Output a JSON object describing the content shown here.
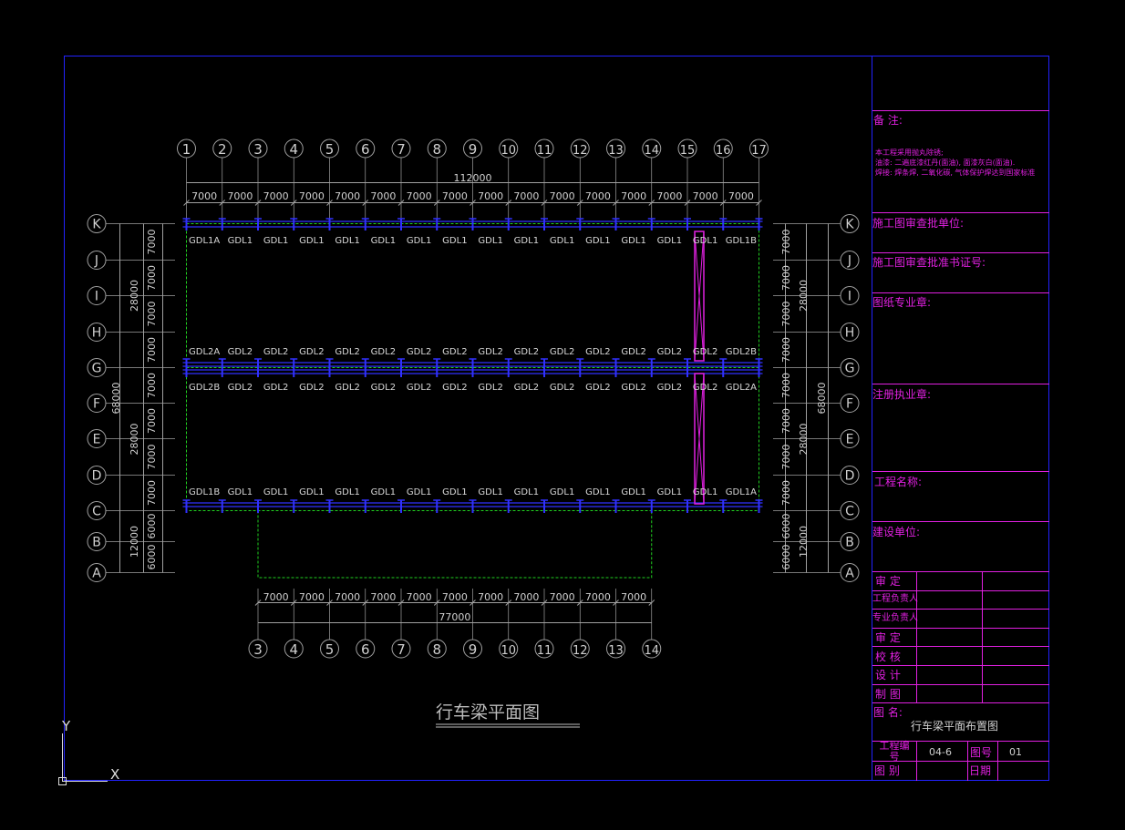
{
  "drawing": {
    "title": "行车梁平面图",
    "total_width": "112000",
    "lower_total_width": "77000",
    "bay": "7000",
    "columns": [
      "1",
      "2",
      "3",
      "4",
      "5",
      "6",
      "7",
      "8",
      "9",
      "10",
      "11",
      "12",
      "13",
      "14",
      "15",
      "16",
      "17"
    ],
    "lower_columns": [
      "3",
      "4",
      "5",
      "6",
      "7",
      "8",
      "9",
      "10",
      "11",
      "12",
      "13",
      "14"
    ],
    "rows": [
      "K",
      "J",
      "I",
      "H",
      "G",
      "F",
      "E",
      "D",
      "C",
      "B",
      "A"
    ],
    "row_spacings": [
      "7000",
      "7000",
      "7000",
      "7000",
      "7000",
      "7000",
      "7000",
      "7000",
      "6000",
      "6000"
    ],
    "group_dims": [
      "28000",
      "28000",
      "12000"
    ],
    "total_height": "68000",
    "beam_rows": [
      [
        "GDL1A",
        "GDL1",
        "GDL1",
        "GDL1",
        "GDL1",
        "GDL1",
        "GDL1",
        "GDL1",
        "GDL1",
        "GDL1",
        "GDL1",
        "GDL1",
        "GDL1",
        "GDL1",
        "GDL1",
        "GDL1B"
      ],
      [
        "GDL2A",
        "GDL2",
        "GDL2",
        "GDL2",
        "GDL2",
        "GDL2",
        "GDL2",
        "GDL2",
        "GDL2",
        "GDL2",
        "GDL2",
        "GDL2",
        "GDL2",
        "GDL2",
        "GDL2",
        "GDL2B"
      ],
      [
        "GDL2B",
        "GDL2",
        "GDL2",
        "GDL2",
        "GDL2",
        "GDL2",
        "GDL2",
        "GDL2",
        "GDL2",
        "GDL2",
        "GDL2",
        "GDL2",
        "GDL2",
        "GDL2",
        "GDL2",
        "GDL2A"
      ],
      [
        "GDL1B",
        "GDL1",
        "GDL1",
        "GDL1",
        "GDL1",
        "GDL1",
        "GDL1",
        "GDL1",
        "GDL1",
        "GDL1",
        "GDL1",
        "GDL1",
        "GDL1",
        "GDL1",
        "GDL1",
        "GDL1A"
      ]
    ],
    "axis_y": "Y",
    "axis_x": "X"
  },
  "title_block": {
    "remarks_label": "备    注:",
    "remarks_lines": [
      "本工程采用抛丸除锈;",
      "油漆: 二遍底漆红丹(面油), 面漆灰白(面油).",
      "焊接: 焊条焊, 二氧化碳, 气体保护焊达到国家标准"
    ],
    "review_unit": "施工图审查批单位:",
    "cert_no": "施工图审查批准书证号:",
    "major_seal": "图纸专业章:",
    "reg_seal": "注册执业章:",
    "project_name": "工程名称:",
    "client": "建设单位:",
    "approve": "审    定",
    "project_lead": "工程负责人",
    "discipline_lead": "专业负责人",
    "review": "审    定",
    "check": "校    核",
    "design": "设    计",
    "draw": "制    图",
    "drawing_name_label": "图    名:",
    "drawing_name": "行车梁平面布置图",
    "project_no_label": "工程编号",
    "project_no": "04-6",
    "drawing_no_label": "图号",
    "drawing_no": "01",
    "category_label": "图    别",
    "date_label": "日期"
  },
  "colors": {
    "frame": "#2222ff",
    "title_block": "#e020e0",
    "grid": "#a0a0a0",
    "beam": "#3030ff",
    "dashed": "#20d020",
    "text": "#d8d8d8"
  }
}
